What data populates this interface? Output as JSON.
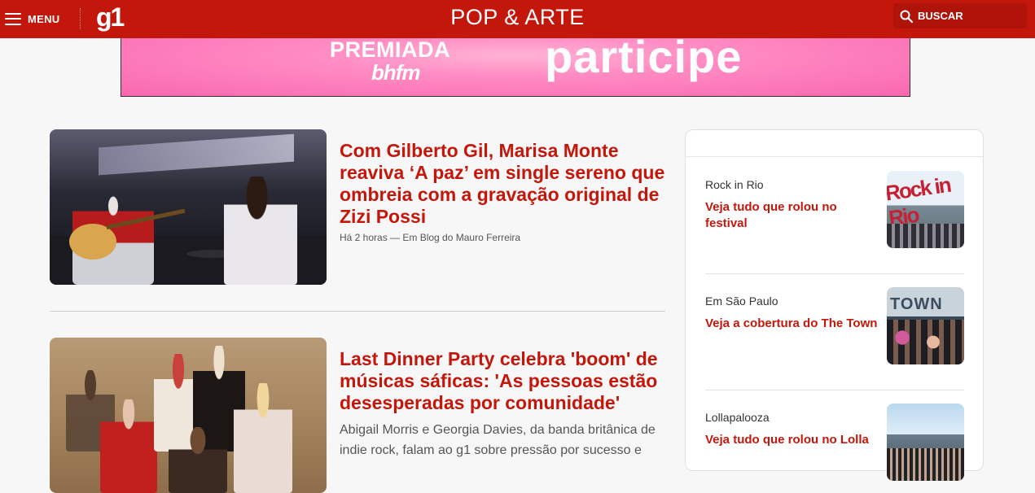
{
  "header": {
    "menu_label": "MENU",
    "logo_text": "g1",
    "section_title": "POP & ARTE",
    "search_label": "BUSCAR",
    "brand_color": "#c4170c"
  },
  "banner": {
    "premiada_text": "PREMIADA",
    "brand_text": "bhfm",
    "cta_text": "participe"
  },
  "feed": [
    {
      "headline": "Com Gilberto Gil, Marisa Monte reaviva ‘A paz’ em single sereno que ombreia com a gravação original de Zizi Possi",
      "meta": "Há 2 horas — Em Blog do Mauro Ferreira"
    },
    {
      "headline": "Last Dinner Party celebra 'boom' de músicas sáficas: 'As pessoas estão desesperadas por comunidade'",
      "summary": "Abigail Morris e Georgia Davies, da banda britânica de indie rock, falam ao g1 sobre pressão por sucesso e"
    }
  ],
  "sidebar": {
    "items": [
      {
        "kicker": "Rock in Rio",
        "title": "Veja tudo que rolou no festival",
        "thumb_text": "Rock in Rio"
      },
      {
        "kicker": "Em São Paulo",
        "title": "Veja a cobertura do The Town",
        "thumb_text": "TOWN"
      },
      {
        "kicker": "Lollapalooza",
        "title": "Veja tudo que rolou no Lolla"
      }
    ]
  },
  "icons": {
    "menu": "hamburger-icon",
    "search": "search-icon"
  }
}
